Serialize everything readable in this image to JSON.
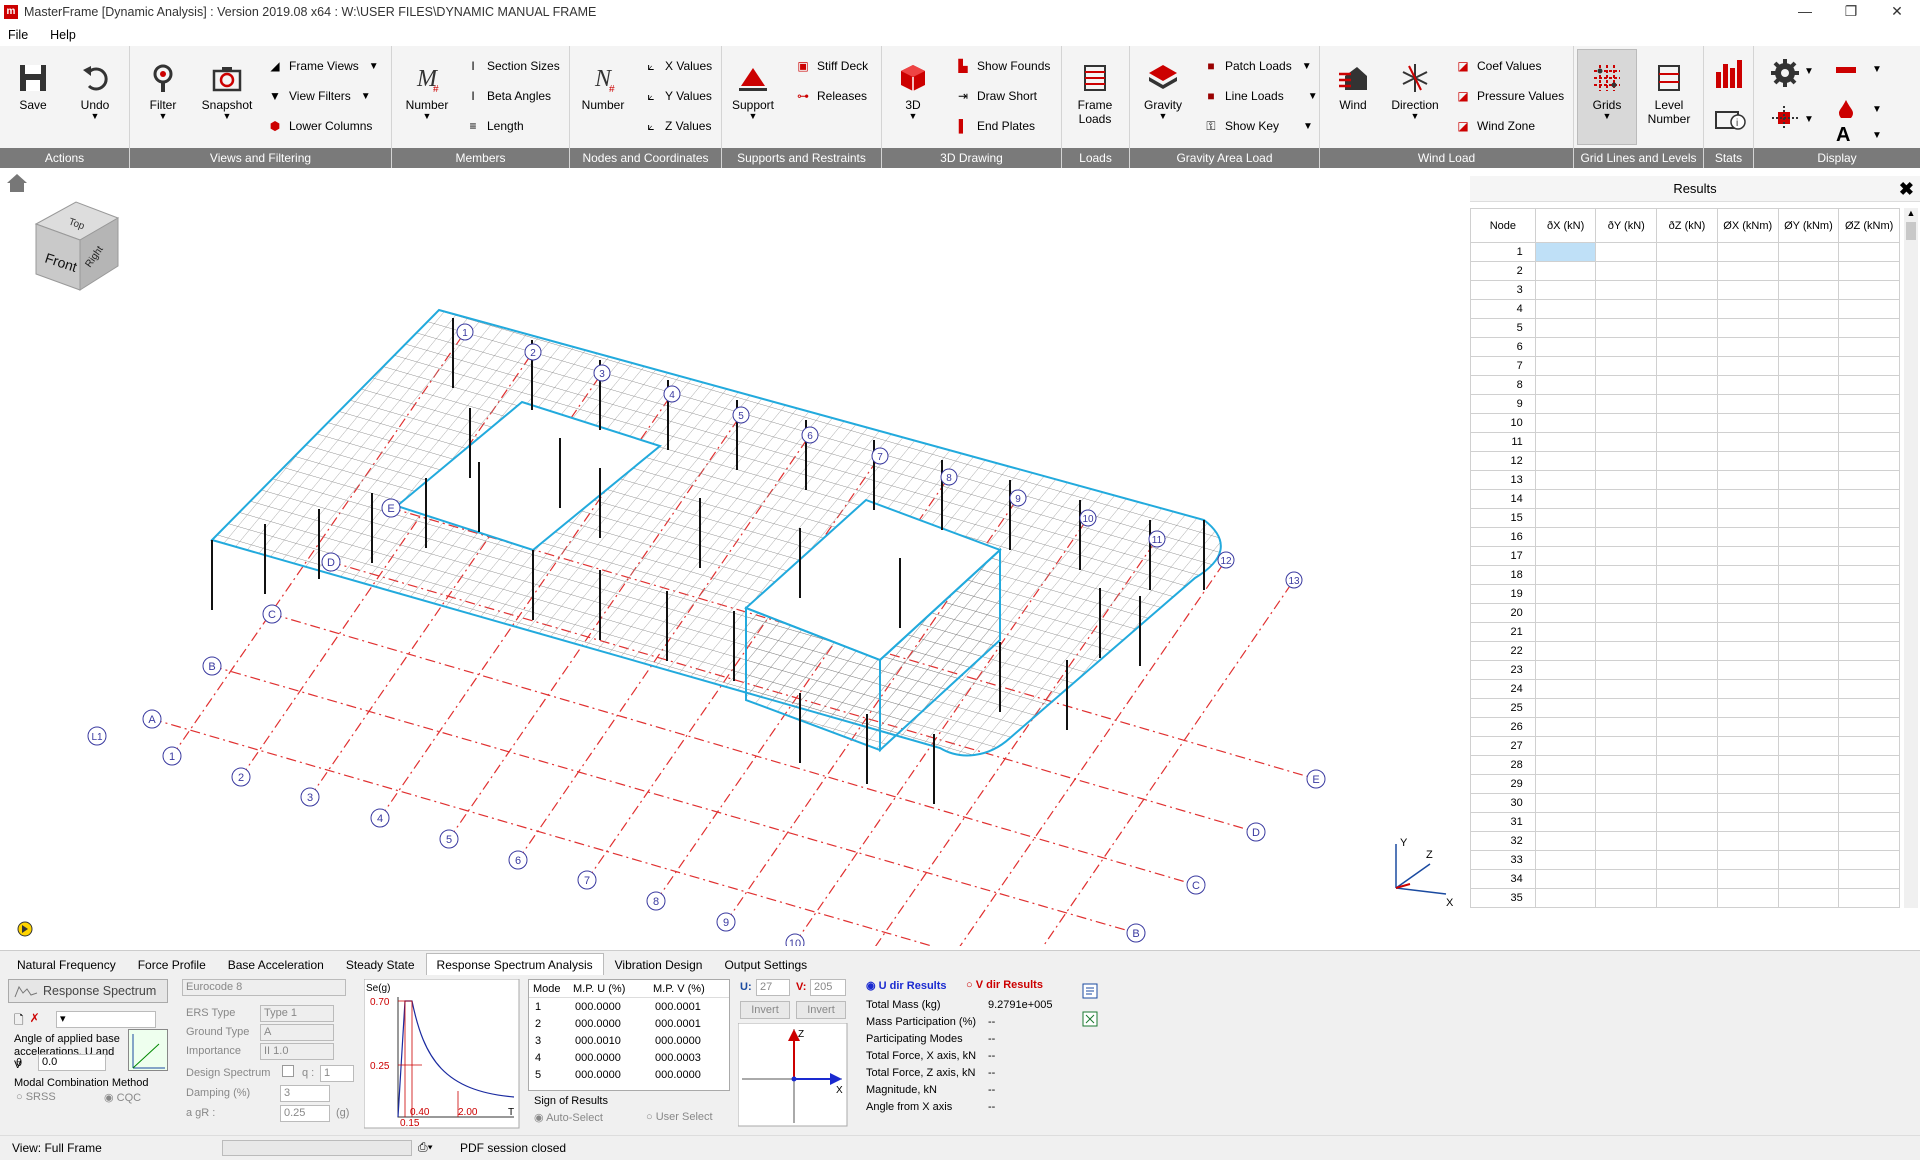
{
  "title": "MasterFrame [Dynamic Analysis] : Version 2019.08 x64 : W:\\USER FILES\\DYNAMIC MANUAL FRAME",
  "menu": [
    "File",
    "Help"
  ],
  "ribbon": {
    "groups": [
      "Actions",
      "Views and Filtering",
      "Members",
      "Nodes and Coordinates",
      "Supports and Restraints",
      "3D Drawing",
      "Loads",
      "Gravity Area Load",
      "Wind Load",
      "Grid Lines and Levels",
      "Stats",
      "Display"
    ],
    "save": "Save",
    "undo": "Undo",
    "filter": "Filter",
    "snapshot": "Snapshot",
    "frame_views": "Frame Views",
    "view_filters": "View Filters",
    "lower_columns": "Lower Columns",
    "member_number": "Number",
    "section_sizes": "Section Sizes",
    "beta_angles": "Beta Angles",
    "length": "Length",
    "node_number": "Number",
    "x_values": "X Values",
    "y_values": "Y Values",
    "z_values": "Z Values",
    "support": "Support",
    "stiff_deck": "Stiff Deck",
    "releases": "Releases",
    "three_d": "3D",
    "show_founds": "Show Founds",
    "draw_short": "Draw Short",
    "end_plates": "End Plates",
    "frame_loads_1": "Frame",
    "frame_loads_2": "Loads",
    "gravity": "Gravity",
    "patch_loads": "Patch Loads",
    "line_loads": "Line Loads",
    "show_key": "Show Key",
    "wind": "Wind",
    "direction": "Direction",
    "coef_values": "Coef Values",
    "pressure_values": "Pressure Values",
    "wind_zone": "Wind Zone",
    "grids": "Grids",
    "level_number_1": "Level",
    "level_number_2": "Number"
  },
  "viewcube": {
    "top": "Top",
    "front": "Front",
    "right": "Right"
  },
  "model": {
    "grid_numbers": [
      "1",
      "2",
      "3",
      "4",
      "5",
      "6",
      "7",
      "8",
      "9",
      "10",
      "11",
      "12",
      "13"
    ],
    "grid_letters": [
      "A",
      "B",
      "C",
      "D",
      "E"
    ],
    "level_label": "L1"
  },
  "axes": {
    "y": "Y",
    "z": "Z",
    "x": "X"
  },
  "results": {
    "title": "Results",
    "columns": [
      "Node",
      "ðX (kN)",
      "ðY (kN)",
      "ðZ (kN)",
      "ØX (kNm)",
      "ØY (kNm)",
      "ØZ (kNm)"
    ],
    "rows": [
      "1",
      "2",
      "3",
      "4",
      "5",
      "6",
      "7",
      "8",
      "9",
      "10",
      "11",
      "12",
      "13",
      "14",
      "15",
      "16",
      "17",
      "18",
      "19",
      "20",
      "21",
      "22",
      "23",
      "24",
      "25",
      "26",
      "27",
      "28",
      "29",
      "30",
      "31",
      "32",
      "33",
      "34",
      "35"
    ]
  },
  "bottom": {
    "tabs": [
      "Natural Frequency",
      "Force Profile",
      "Base Acceleration",
      "Steady State",
      "Response Spectrum Analysis",
      "Vibration Design",
      "Output Settings"
    ],
    "active_tab": "Response Spectrum Analysis",
    "rs_button": "Response Spectrum",
    "angle_label": "Angle of applied base accelerations, U and V",
    "theta_label": "θ",
    "theta_value": "0.0",
    "modal_method": "Modal Combination Method",
    "srss": "SRSS",
    "cqc": "CQC",
    "code": "Eurocode 8",
    "ers_type_label": "ERS Type",
    "ers_type": "Type 1",
    "ground_type_label": "Ground Type",
    "ground_type": "A",
    "importance_label": "Importance",
    "importance": "II 1.0",
    "design_spectrum": "Design Spectrum",
    "q_label": "q :",
    "q_value": "1",
    "damping_label": "Damping (%)",
    "damping_value": "3",
    "agr_label": "a gR :",
    "agr_value": "0.25",
    "agr_unit": "(g)",
    "spectrum": {
      "ylabel": "Se(g)",
      "y_top": "0.70",
      "y_mid": "0.25",
      "x1": "0.15",
      "x2": "0.40",
      "x3": "2.00",
      "xunit": "T"
    },
    "mode_table": {
      "headers": [
        "Mode",
        "M.P. U (%)",
        "M.P. V (%)"
      ],
      "rows": [
        [
          "1",
          "000.0000",
          "000.0001"
        ],
        [
          "2",
          "000.0000",
          "000.0001"
        ],
        [
          "3",
          "000.0010",
          "000.0000"
        ],
        [
          "4",
          "000.0000",
          "000.0003"
        ],
        [
          "5",
          "000.0000",
          "000.0000"
        ]
      ]
    },
    "sign_results": "Sign of Results",
    "auto_select": "Auto-Select",
    "user_select": "User Select",
    "u_label": "U:",
    "u_value": "27",
    "v_label": "V:",
    "v_value": "205",
    "invert": "Invert",
    "u_dir": "U dir Results",
    "v_dir": "V dir Results",
    "summary": [
      [
        "Total Mass (kg)",
        "9.2791e+005"
      ],
      [
        "Mass Participation (%)",
        "--"
      ],
      [
        "Participating Modes",
        "--"
      ],
      [
        "Total Force, X axis, kN",
        "--"
      ],
      [
        "Total Force, Z axis, kN",
        "--"
      ],
      [
        "Magnitude, kN",
        "--"
      ],
      [
        "Angle from X axis",
        "--"
      ]
    ]
  },
  "status": {
    "view": "View: Full Frame",
    "pdf": "PDF session closed"
  }
}
